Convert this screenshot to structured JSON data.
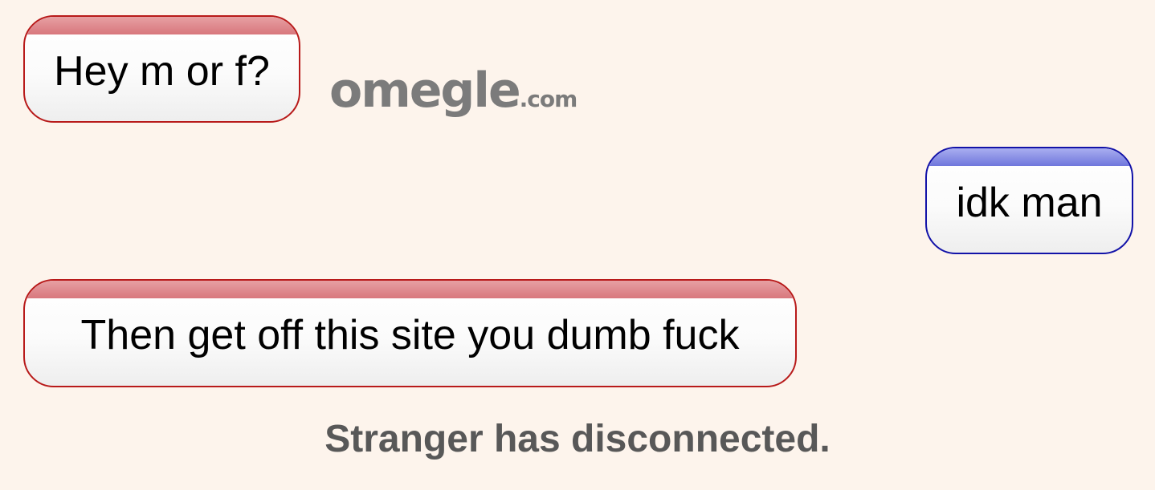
{
  "conversation": {
    "messages": [
      {
        "sender": "stranger",
        "text": "Hey m or f?",
        "accent": "#b81a1a"
      },
      {
        "sender": "you",
        "text": "idk man",
        "accent": "#1212a8"
      },
      {
        "sender": "stranger",
        "text": "Then get off this site you dumb fuck",
        "accent": "#b81a1a"
      }
    ]
  },
  "watermark": {
    "name": "omegle",
    "domain_suffix": ".com",
    "color": "#7b7b7b"
  },
  "status": {
    "text": "Stranger has disconnected.",
    "color": "#585858"
  },
  "colors": {
    "background": "#fdf4ec"
  }
}
